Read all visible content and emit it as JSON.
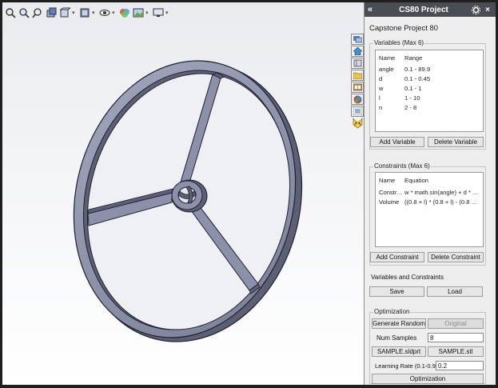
{
  "toolbar": {
    "icons": [
      "zoom-to-fit-icon",
      "zoom-area-icon",
      "previous-view-icon",
      "section-view-icon",
      "view-orientation-icon",
      "display-style-icon",
      "hide-show-icon",
      "edit-appearance-icon",
      "apply-scene-icon",
      "view-settings-icon"
    ]
  },
  "task_pane": {
    "icons": [
      "resources-icon",
      "home-icon",
      "design-library-icon",
      "file-explorer-icon",
      "view-palette-icon",
      "appearances-icon",
      "custom-properties-icon",
      "addin-mascot-icon"
    ]
  },
  "panel": {
    "title": "CS80 Project",
    "project_name": "Capstone Project 80",
    "variables": {
      "label": "Variables (Max 6)",
      "headers": [
        "Name",
        "Range"
      ],
      "rows": [
        [
          "angle",
          "0.1 - 89.9"
        ],
        [
          "d",
          "0.1 - 0.45"
        ],
        [
          "w",
          "0.1 - 1"
        ],
        [
          "l",
          "1 - 10"
        ],
        [
          "n",
          "2 - 8"
        ]
      ],
      "add_label": "Add Variable",
      "delete_label": "Delete Variable"
    },
    "constraints": {
      "label": "Constraints (Max 6)",
      "headers": [
        "Name",
        "Equation"
      ],
      "rows": [
        [
          "Constrai...",
          "w * math.sin(angle) + d * ..."
        ],
        [
          "Volume",
          "((0.8 + l) * (0.8 + l) - (0.8 + l..."
        ]
      ],
      "add_label": "Add Constraint",
      "delete_label": "Delete Constraint"
    },
    "var_and_con": {
      "label": "Variables and Constraints",
      "save_label": "Save",
      "load_label": "Load"
    },
    "optimization": {
      "label": "Optimization",
      "generate_label": "Generate Random",
      "original_label": "Original",
      "num_samples_label": "Num Samples",
      "num_samples_value": "8",
      "sldprt_label": "SAMPLE.sldprt",
      "stl_label": "SAMPLE.stl",
      "learning_rate_label": "Learning Rate (0.1-0.9)",
      "learning_rate_value": "0.2",
      "run_label": "Optimization"
    }
  },
  "colors": {
    "model_face": "#8c90a8",
    "model_dark": "#5d6075",
    "model_edge": "#1f2030",
    "title_bar": "#4a4d52",
    "panel_bg": "#eeeeee"
  }
}
